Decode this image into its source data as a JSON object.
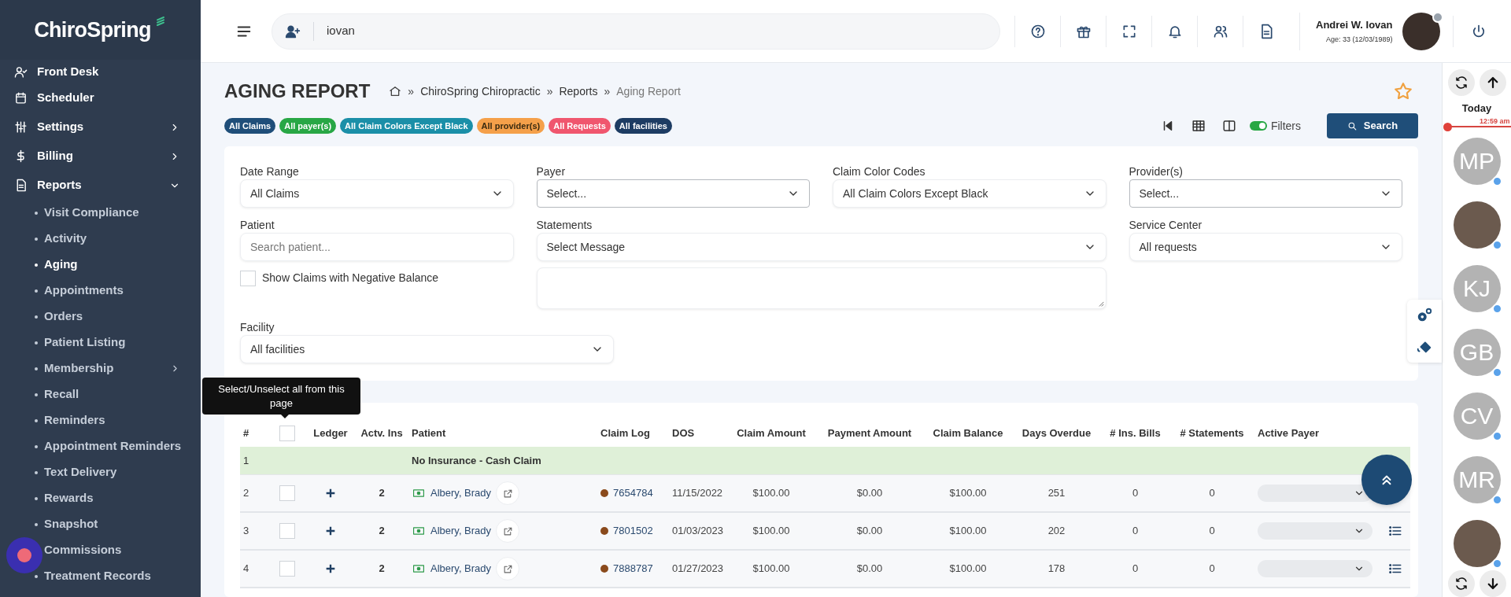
{
  "sidebar": {
    "logo": "ChiroSpring",
    "items": [
      {
        "label": "Front Desk"
      },
      {
        "label": "Scheduler"
      },
      {
        "label": "Settings",
        "expanded": false
      },
      {
        "label": "Billing",
        "expanded": false
      },
      {
        "label": "Reports",
        "expanded": true,
        "children": [
          {
            "label": "Visit Compliance",
            "selected": false
          },
          {
            "label": "Activity",
            "selected": false
          },
          {
            "label": "Aging",
            "selected": true
          },
          {
            "label": "Appointments",
            "selected": false
          },
          {
            "label": "Orders",
            "selected": false
          },
          {
            "label": "Patient Listing",
            "selected": false
          },
          {
            "label": "Membership",
            "selected": false,
            "expanded": false
          },
          {
            "label": "Recall",
            "selected": false
          },
          {
            "label": "Reminders",
            "selected": false
          },
          {
            "label": "Appointment Reminders",
            "selected": false
          },
          {
            "label": "Text Delivery",
            "selected": false
          },
          {
            "label": "Rewards",
            "selected": false
          },
          {
            "label": "Snapshot",
            "selected": false
          },
          {
            "label": "Commissions",
            "selected": false
          },
          {
            "label": "Treatment Records",
            "selected": false
          }
        ]
      }
    ]
  },
  "topbar": {
    "search": {
      "value": "iovan"
    },
    "user": {
      "name": "Andrei W. Iovan",
      "detail": "Age: 33 (12/03/1989)"
    }
  },
  "page": {
    "title": "AGING REPORT",
    "breadcrumb": [
      "ChiroSpring Chiropractic",
      "Reports",
      "Aging Report"
    ],
    "breadcrumb_separator": "»",
    "favorite": false,
    "chips": [
      {
        "label": "All Claims",
        "color": "#1f4e79"
      },
      {
        "label": "All payer(s)",
        "color": "#28a745"
      },
      {
        "label": "All Claim Colors Except Black",
        "color": "#1b8fa8"
      },
      {
        "label": "All provider(s)",
        "color": "#f5a04a"
      },
      {
        "label": "All Requests",
        "color": "#f0566e"
      },
      {
        "label": "All facilities",
        "color": "#1d3c63"
      }
    ],
    "filters_toggle": {
      "label": "Filters",
      "on": true
    },
    "search_button": "Search"
  },
  "filters": {
    "date_range": {
      "label": "Date Range",
      "value": "All Claims"
    },
    "payer": {
      "label": "Payer",
      "value": "Select..."
    },
    "claim_color_codes": {
      "label": "Claim Color Codes",
      "value": "All Claim Colors Except Black"
    },
    "providers": {
      "label": "Provider(s)",
      "value": "Select..."
    },
    "patient": {
      "label": "Patient",
      "placeholder": "Search patient..."
    },
    "negative_balance": {
      "label": "Show Claims with Negative Balance",
      "checked": false
    },
    "statements": {
      "label": "Statements",
      "value": "Select Message"
    },
    "service_center": {
      "label": "Service Center",
      "value": "All requests"
    },
    "facility": {
      "label": "Facility",
      "value": "All facilities"
    }
  },
  "table": {
    "tooltip": "Select/Unselect all from this page",
    "select_all": {
      "checked": false
    },
    "columns": [
      "#",
      "Ledger",
      "Actv. Ins",
      "Patient",
      "Claim Log",
      "DOS",
      "Claim Amount",
      "Payment Amount",
      "Claim Balance",
      "Days Overdue",
      "# Ins. Bills",
      "# Statements",
      "Active Payer"
    ],
    "rows": [
      {
        "kind": "group",
        "number": "1",
        "label": "No Insurance - Cash Claim"
      },
      {
        "kind": "claim",
        "number": "2",
        "checked": false,
        "actv_ins": "2",
        "patient": "Albery, Brady",
        "claim_log": "7654784",
        "dos": "11/15/2022",
        "claim_amount": "$100.00",
        "payment_amount": "$0.00",
        "claim_balance": "$100.00",
        "days_overdue": "251",
        "ins_bills": "0",
        "statements": "0"
      },
      {
        "kind": "claim",
        "number": "3",
        "checked": false,
        "actv_ins": "2",
        "patient": "Albery, Brady",
        "claim_log": "7801502",
        "dos": "01/03/2023",
        "claim_amount": "$100.00",
        "payment_amount": "$0.00",
        "claim_balance": "$100.00",
        "days_overdue": "202",
        "ins_bills": "0",
        "statements": "0"
      },
      {
        "kind": "claim",
        "number": "4",
        "checked": false,
        "actv_ins": "2",
        "patient": "Albery, Brady",
        "claim_log": "7888787",
        "dos": "01/27/2023",
        "claim_amount": "$100.00",
        "payment_amount": "$0.00",
        "claim_balance": "$100.00",
        "days_overdue": "178",
        "ins_bills": "0",
        "statements": "0"
      }
    ]
  },
  "schedule_panel": {
    "day": "Today",
    "time": "12:59 am",
    "providers": [
      {
        "kind": "initials",
        "initials": "MP"
      },
      {
        "kind": "photo"
      },
      {
        "kind": "initials",
        "initials": "KJ"
      },
      {
        "kind": "initials",
        "initials": "GB"
      },
      {
        "kind": "initials",
        "initials": "CV"
      },
      {
        "kind": "initials",
        "initials": "MR"
      },
      {
        "kind": "photo"
      }
    ]
  }
}
